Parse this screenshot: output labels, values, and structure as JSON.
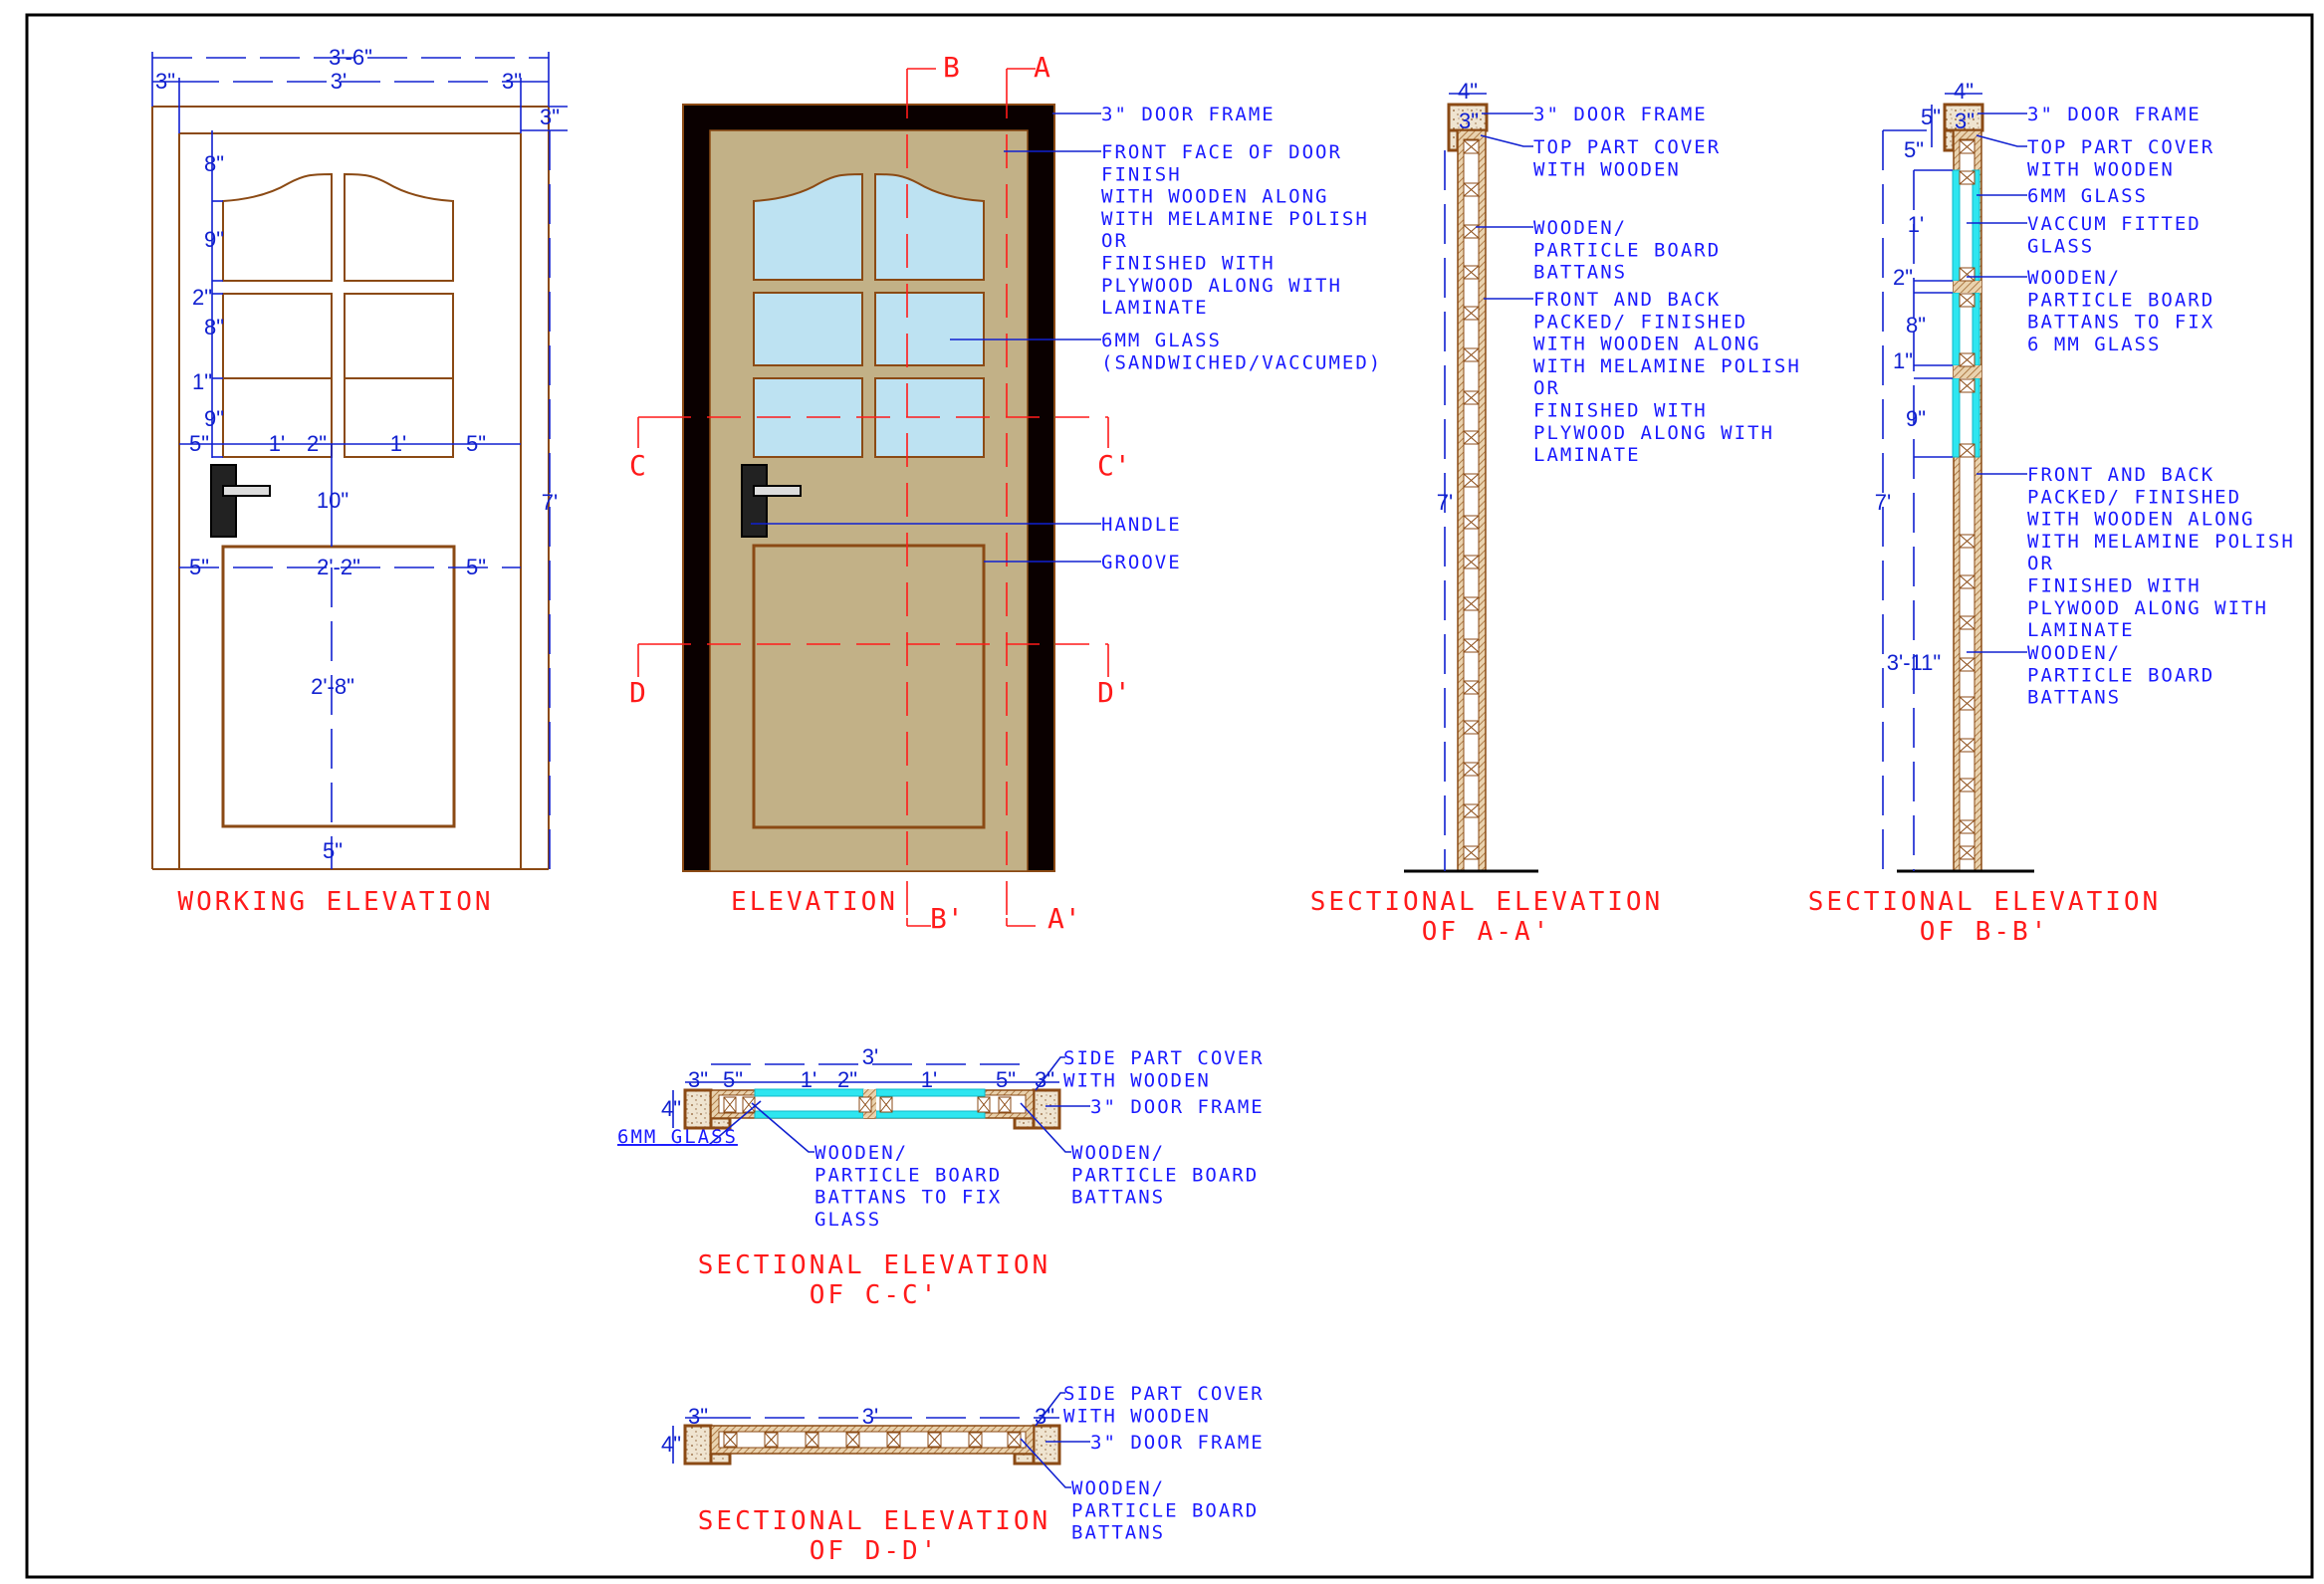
{
  "colors": {
    "annotation": "#1a1aff",
    "title": "#ff1a1a",
    "wood_line": "#8b4a14",
    "door_fill": "#c2b187",
    "frame_fill": "#0a0000",
    "glass_fill": "#bde2f2",
    "glass_section": "#2ee6f0",
    "hatch": "#b07a44"
  },
  "working_elevation": {
    "title": "WORKING ELEVATION",
    "dims": {
      "overall_width": "3'-6\"",
      "door_width": "3'",
      "frame_left": "3\"",
      "frame_right": "3\"",
      "frame_top": "3\"",
      "top_rail": "8\"",
      "glass_row1": "9\"",
      "rail1": "2\"",
      "glass_row2": "8\"",
      "rail2": "1\"",
      "glass_row3": "9\"",
      "stile_left": "5\"",
      "glass_w1": "1'",
      "mullion": "2\"",
      "glass_w2": "1'",
      "stile_right": "5\"",
      "lock_rail": "10\"",
      "panel_left": "5\"",
      "panel_width": "2'-2\"",
      "panel_right": "5\"",
      "panel_height": "2'-8\"",
      "bottom_rail": "5\"",
      "overall_height": "7'"
    }
  },
  "elevation": {
    "title": "ELEVATION",
    "section_marks": {
      "a": "A",
      "a_prime": "A'",
      "b": "B",
      "b_prime": "B'",
      "c": "C",
      "c_prime": "C'",
      "d": "D",
      "d_prime": "D'"
    },
    "notes": {
      "frame": "3\" DOOR FRAME",
      "front_face": [
        "FRONT FACE OF DOOR",
        "FINISH",
        "WITH WOODEN ALONG",
        "WITH MELAMINE POLISH",
        "OR",
        "FINISHED WITH",
        "PLYWOOD ALONG WITH",
        "LAMINATE"
      ],
      "glass": [
        "6MM GLASS",
        "(SANDWICHED/VACCUMED)"
      ],
      "handle": "HANDLE",
      "groove": "GROOVE"
    }
  },
  "section_aa": {
    "title": [
      "SECTIONAL ELEVATION",
      "OF A-A'"
    ],
    "dims": {
      "frame_depth": "4\"",
      "frame_width": "3\"",
      "height": "7'"
    },
    "notes": {
      "frame": "3\" DOOR FRAME",
      "top_cover": [
        "TOP PART COVER",
        "WITH WOODEN"
      ],
      "battans": [
        "WOODEN/",
        "PARTICLE BOARD",
        "BATTANS"
      ],
      "finish": [
        "FRONT AND BACK",
        "PACKED/ FINISHED",
        "WITH WOODEN ALONG",
        "WITH MELAMINE POLISH",
        "OR",
        "FINISHED WITH",
        "PLYWOOD ALONG WITH",
        "LAMINATE"
      ]
    }
  },
  "section_bb": {
    "title": [
      "SECTIONAL ELEVATION",
      "OF B-B'"
    ],
    "dims": {
      "frame_depth": "4\"",
      "frame_width": "3\"",
      "frame_height": "5\"",
      "top_rail": "5\"",
      "glass1": "1'",
      "rail1": "2\"",
      "glass2": "8\"",
      "rail2": "1\"",
      "glass3": "9\"",
      "lower": "3'-11\"",
      "height": "7'"
    },
    "notes": {
      "frame": "3\" DOOR FRAME",
      "top_cover": [
        "TOP PART COVER",
        "WITH WOODEN"
      ],
      "glass": "6MM GLASS",
      "vacuum": [
        "VACCUM FITTED",
        "GLASS"
      ],
      "battans_glass": [
        "WOODEN/",
        "PARTICLE BOARD",
        "BATTANS TO FIX",
        "6 MM GLASS"
      ],
      "finish": [
        "FRONT AND BACK",
        "PACKED/ FINISHED",
        "WITH WOODEN ALONG",
        "WITH MELAMINE POLISH",
        "OR",
        "FINISHED WITH",
        "PLYWOOD ALONG WITH",
        "LAMINATE"
      ],
      "battans": [
        "WOODEN/",
        "PARTICLE BOARD",
        "BATTANS"
      ]
    }
  },
  "section_cc": {
    "title": [
      "SECTIONAL ELEVATION",
      "OF C-C'"
    ],
    "dims": {
      "overall": "3'",
      "frame_l": "3\"",
      "stile_l": "5\"",
      "glass1": "1'",
      "mullion": "2\"",
      "glass2": "1'",
      "stile_r": "5\"",
      "frame_r": "3\"",
      "depth": "4\""
    },
    "notes": {
      "side_cover": [
        "SIDE PART COVER",
        "WITH WOODEN"
      ],
      "frame": "3\" DOOR FRAME",
      "glass": "6MM GLASS",
      "battans_glass": [
        "WOODEN/",
        "PARTICLE BOARD",
        "BATTANS TO FIX",
        "GLASS"
      ],
      "battans": [
        "WOODEN/",
        "PARTICLE BOARD",
        "BATTANS"
      ]
    }
  },
  "section_dd": {
    "title": [
      "SECTIONAL ELEVATION",
      "OF D-D'"
    ],
    "dims": {
      "overall": "3'",
      "frame_l": "3\"",
      "frame_r": "3\"",
      "depth": "4\""
    },
    "notes": {
      "side_cover": [
        "SIDE PART COVER",
        "WITH WOODEN"
      ],
      "frame": "3\" DOOR FRAME",
      "battans": [
        "WOODEN/",
        "PARTICLE BOARD",
        "BATTANS"
      ]
    }
  }
}
